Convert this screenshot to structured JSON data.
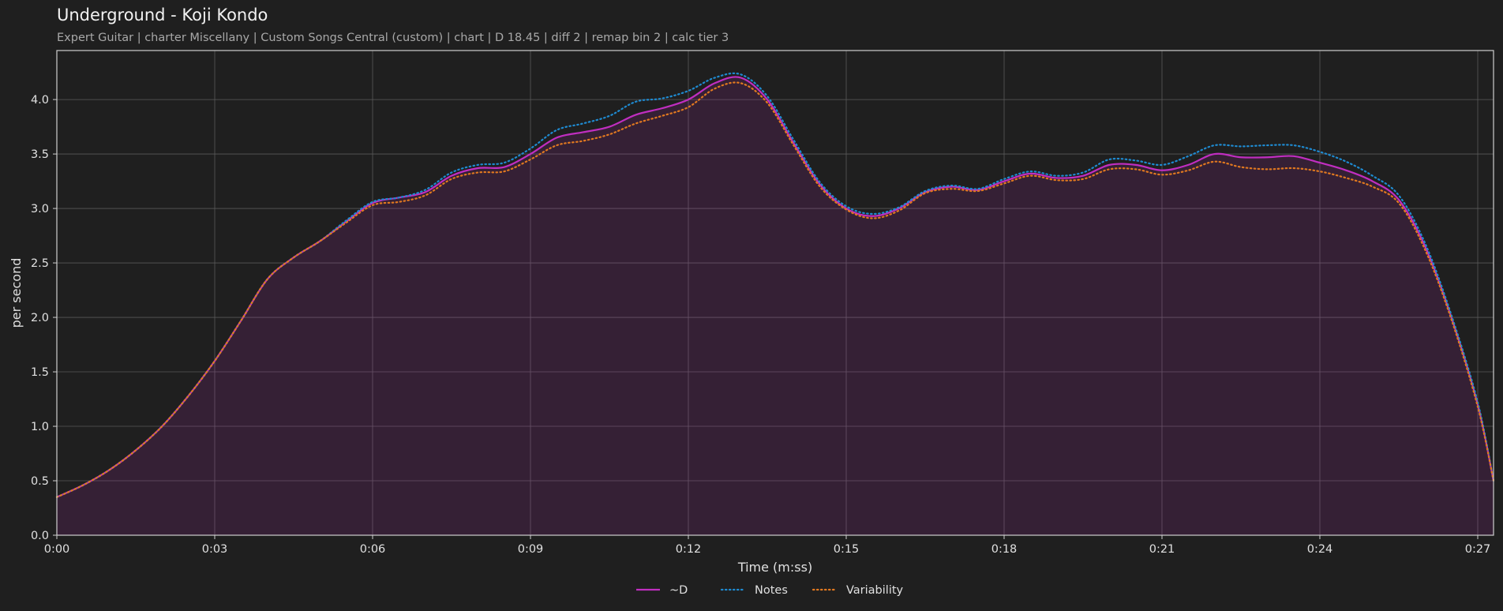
{
  "title": "Underground - Koji Kondo",
  "subtitle": "Expert Guitar  |  charter Miscellany  |  Custom Songs Central (custom)  |  chart  |  D 18.45  |  diff 2  |  remap bin 2  |  calc tier 3",
  "chart_data": {
    "type": "line",
    "title": "Underground - Koji Kondo",
    "subtitle": "Expert Guitar  |  charter Miscellany  |  Custom Songs Central (custom)  |  chart  |  D 18.45  |  diff 2  |  remap bin 2  |  calc tier 3",
    "xlabel": "Time (m:ss)",
    "ylabel": "per second",
    "xlim": [
      0,
      27.3
    ],
    "ylim": [
      0,
      4.45
    ],
    "x_ticks": [
      0,
      3,
      6,
      9,
      12,
      15,
      18,
      21,
      24,
      27
    ],
    "x_tick_labels": [
      "0:00",
      "0:03",
      "0:06",
      "0:09",
      "0:12",
      "0:15",
      "0:18",
      "0:21",
      "0:24",
      "0:27"
    ],
    "y_ticks": [
      0,
      0.5,
      1.0,
      1.5,
      2.0,
      2.5,
      3.0,
      3.5,
      4.0
    ],
    "y_tick_labels": [
      "0.0",
      "0.5",
      "1.0",
      "1.5",
      "2.0",
      "2.5",
      "3.0",
      "3.5",
      "4.0"
    ],
    "grid": true,
    "legend_position": "bottom-center",
    "series": [
      {
        "name": "~D",
        "color": "#c02ec0",
        "style": "solid",
        "filled": true,
        "x": [
          0,
          0.5,
          1.0,
          1.5,
          2.0,
          2.5,
          3.0,
          3.5,
          4.0,
          4.5,
          5.0,
          5.5,
          6.0,
          6.5,
          7.0,
          7.5,
          8.0,
          8.5,
          9.0,
          9.5,
          10.0,
          10.5,
          11.0,
          11.5,
          12.0,
          12.5,
          13.0,
          13.5,
          14.0,
          14.5,
          15.0,
          15.5,
          16.0,
          16.5,
          17.0,
          17.5,
          18.0,
          18.5,
          19.0,
          19.5,
          20.0,
          20.5,
          21.0,
          21.5,
          22.0,
          22.5,
          23.0,
          23.5,
          24.0,
          24.5,
          25.0,
          25.5,
          26.0,
          26.5,
          27.0,
          27.3
        ],
        "y": [
          0.35,
          0.46,
          0.6,
          0.78,
          1.0,
          1.28,
          1.6,
          1.97,
          2.35,
          2.55,
          2.7,
          2.88,
          3.05,
          3.1,
          3.15,
          3.3,
          3.37,
          3.38,
          3.5,
          3.65,
          3.7,
          3.75,
          3.86,
          3.92,
          4.0,
          4.15,
          4.2,
          4.0,
          3.6,
          3.22,
          3.0,
          2.93,
          3.0,
          3.15,
          3.2,
          3.17,
          3.25,
          3.32,
          3.28,
          3.3,
          3.4,
          3.4,
          3.35,
          3.4,
          3.5,
          3.47,
          3.47,
          3.48,
          3.42,
          3.35,
          3.25,
          3.08,
          2.65,
          2.0,
          1.2,
          0.5
        ]
      },
      {
        "name": "Notes",
        "color": "#1f8ad0",
        "style": "dotted",
        "x": [
          0,
          0.5,
          1.0,
          1.5,
          2.0,
          2.5,
          3.0,
          3.5,
          4.0,
          4.5,
          5.0,
          5.5,
          6.0,
          6.5,
          7.0,
          7.5,
          8.0,
          8.5,
          9.0,
          9.5,
          10.0,
          10.5,
          11.0,
          11.5,
          12.0,
          12.5,
          13.0,
          13.5,
          14.0,
          14.5,
          15.0,
          15.5,
          16.0,
          16.5,
          17.0,
          17.5,
          18.0,
          18.5,
          19.0,
          19.5,
          20.0,
          20.5,
          21.0,
          21.5,
          22.0,
          22.5,
          23.0,
          23.5,
          24.0,
          24.5,
          25.0,
          25.5,
          26.0,
          26.5,
          27.0,
          27.3
        ],
        "y": [
          0.35,
          0.46,
          0.6,
          0.78,
          1.0,
          1.28,
          1.6,
          1.97,
          2.35,
          2.55,
          2.7,
          2.89,
          3.06,
          3.1,
          3.17,
          3.33,
          3.4,
          3.42,
          3.55,
          3.72,
          3.78,
          3.85,
          3.98,
          4.01,
          4.08,
          4.2,
          4.23,
          4.03,
          3.63,
          3.24,
          3.02,
          2.95,
          3.01,
          3.16,
          3.21,
          3.18,
          3.27,
          3.34,
          3.3,
          3.33,
          3.45,
          3.44,
          3.4,
          3.48,
          3.58,
          3.57,
          3.58,
          3.58,
          3.52,
          3.43,
          3.3,
          3.12,
          2.68,
          2.02,
          1.22,
          0.5
        ]
      },
      {
        "name": "Variability",
        "color": "#e07820",
        "style": "dotted",
        "x": [
          0,
          0.5,
          1.0,
          1.5,
          2.0,
          2.5,
          3.0,
          3.5,
          4.0,
          4.5,
          5.0,
          5.5,
          6.0,
          6.5,
          7.0,
          7.5,
          8.0,
          8.5,
          9.0,
          9.5,
          10.0,
          10.5,
          11.0,
          11.5,
          12.0,
          12.5,
          13.0,
          13.5,
          14.0,
          14.5,
          15.0,
          15.5,
          16.0,
          16.5,
          17.0,
          17.5,
          18.0,
          18.5,
          19.0,
          19.5,
          20.0,
          20.5,
          21.0,
          21.5,
          22.0,
          22.5,
          23.0,
          23.5,
          24.0,
          24.5,
          25.0,
          25.5,
          26.0,
          26.5,
          27.0,
          27.3
        ],
        "y": [
          0.35,
          0.46,
          0.6,
          0.78,
          1.0,
          1.28,
          1.6,
          1.97,
          2.35,
          2.55,
          2.7,
          2.87,
          3.03,
          3.06,
          3.12,
          3.27,
          3.33,
          3.34,
          3.45,
          3.58,
          3.62,
          3.68,
          3.78,
          3.85,
          3.93,
          4.1,
          4.15,
          3.97,
          3.58,
          3.2,
          2.99,
          2.91,
          2.98,
          3.14,
          3.18,
          3.16,
          3.23,
          3.3,
          3.26,
          3.27,
          3.36,
          3.36,
          3.31,
          3.35,
          3.43,
          3.38,
          3.36,
          3.37,
          3.34,
          3.28,
          3.2,
          3.05,
          2.62,
          1.98,
          1.18,
          0.5
        ]
      }
    ]
  }
}
